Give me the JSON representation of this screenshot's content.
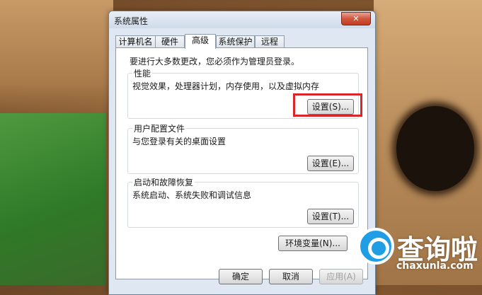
{
  "window": {
    "title": "系统属性",
    "close_label": "✕"
  },
  "tabs": [
    "计算机名",
    "硬件",
    "高级",
    "系统保护",
    "远程"
  ],
  "notice": "要进行大多数更改，您必须作为管理员登录。",
  "performance": {
    "title": "性能",
    "desc": "视觉效果，处理器计划，内存使用，以及虚拟内存",
    "button": "设置(S)..."
  },
  "profile": {
    "title": "用户配置文件",
    "desc": "与您登录有关的桌面设置",
    "button": "设置(E)..."
  },
  "startup": {
    "title": "启动和故障恢复",
    "desc": "系统启动、系统失败和调试信息",
    "button": "设置(T)..."
  },
  "env_button": "环境变量(N)...",
  "footer": {
    "ok": "确定",
    "cancel": "取消",
    "apply": "应用(A)"
  },
  "watermark": {
    "brand": "查询啦",
    "url": "chaxunla.com"
  },
  "colors": {
    "highlight": "#d9262b",
    "brand": "#1f9ee6"
  }
}
